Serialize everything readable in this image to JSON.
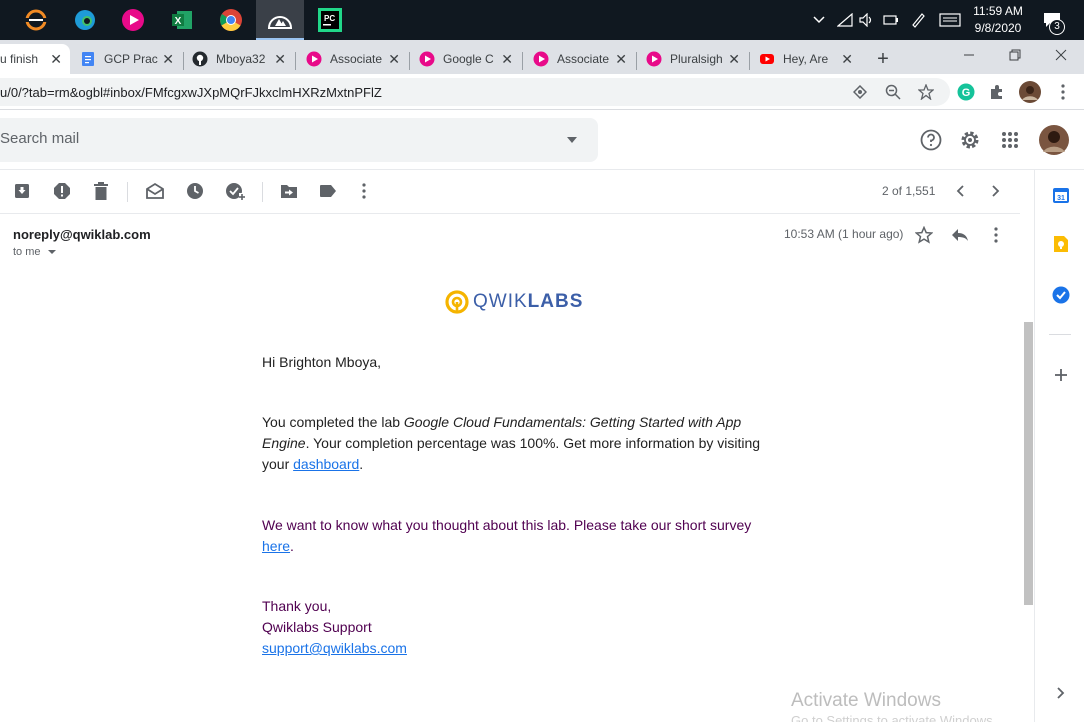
{
  "taskbar": {
    "apps": [
      {
        "name": "eclipse-icon"
      },
      {
        "name": "edge-icon"
      },
      {
        "name": "pluralsight-app-icon"
      },
      {
        "name": "excel-icon"
      },
      {
        "name": "chrome-icon"
      },
      {
        "name": "app-logo-icon"
      },
      {
        "name": "pycharm-icon"
      }
    ],
    "time": "11:59 AM",
    "date": "9/8/2020",
    "notification_count": "3"
  },
  "tabs": [
    {
      "title": "u finish",
      "favicon": "gmail"
    },
    {
      "title": "GCP Prac",
      "favicon": "docs"
    },
    {
      "title": "Mboya32",
      "favicon": "github"
    },
    {
      "title": "Associate",
      "favicon": "pluralsight"
    },
    {
      "title": "Google C",
      "favicon": "pluralsight"
    },
    {
      "title": "Associate",
      "favicon": "pluralsight"
    },
    {
      "title": "Pluralsigh",
      "favicon": "pluralsight"
    },
    {
      "title": "Hey, Are",
      "favicon": "youtube"
    }
  ],
  "address": {
    "url": "u/0/?tab=rm&ogbl#inbox/FMfcgxwJXpMQrFJkxclmHXRzMxtnPFlZ"
  },
  "search": {
    "placeholder": "Search mail"
  },
  "toolbar": {
    "pager": "2 of 1,551"
  },
  "message": {
    "sender": "noreply@qwiklab.com",
    "to": "to me",
    "time": "10:53 AM (1 hour ago)",
    "logo_light": "QWIK",
    "logo_bold": "LABS",
    "greeting": "Hi Brighton Mboya,",
    "p1_a": "You completed the lab ",
    "p1_lab": "Google Cloud Fundamentals: Getting Started with App Engine",
    "p1_b": ". Your completion percentage was 100%. Get more information by visiting your ",
    "p1_link": "dashboard",
    "p1_end": ".",
    "p2_a": "We want to know what you thought about this lab. Please take our short survey ",
    "p2_link": "here",
    "p2_end": ".",
    "sign1": "Thank you,",
    "sign2": "Qwiklabs Support",
    "sign_email": "support@qwiklabs.com"
  },
  "watermark": {
    "line1": "Activate Windows",
    "line2": "Go to Settings to activate Windows."
  }
}
